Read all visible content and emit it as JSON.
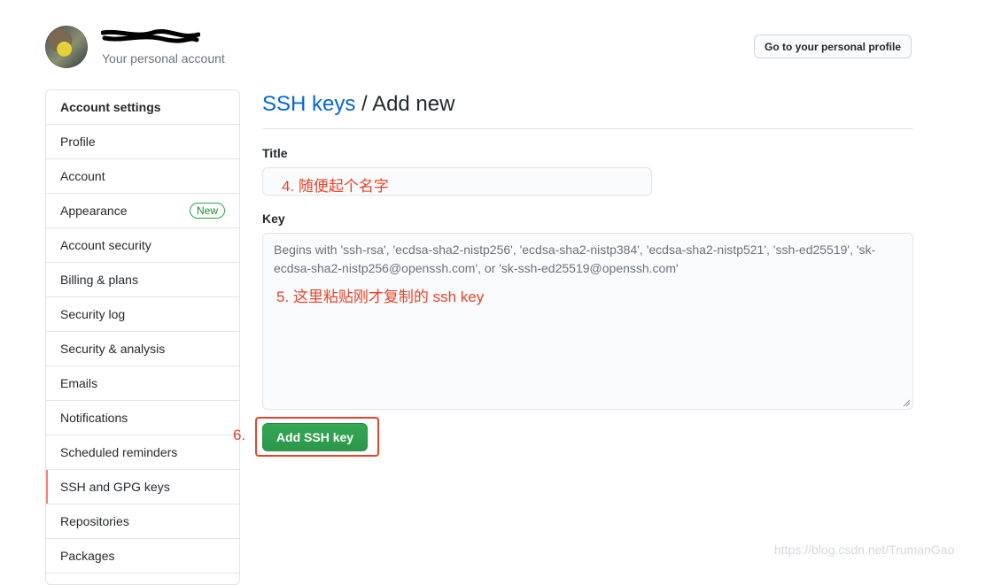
{
  "header": {
    "subtitle": "Your personal account",
    "profile_button": "Go to your personal profile"
  },
  "sidebar": {
    "title": "Account settings",
    "items": [
      {
        "label": "Profile"
      },
      {
        "label": "Account"
      },
      {
        "label": "Appearance",
        "badge": "New"
      },
      {
        "label": "Account security"
      },
      {
        "label": "Billing & plans"
      },
      {
        "label": "Security log"
      },
      {
        "label": "Security & analysis"
      },
      {
        "label": "Emails"
      },
      {
        "label": "Notifications"
      },
      {
        "label": "Scheduled reminders"
      },
      {
        "label": "SSH and GPG keys",
        "selected": true
      },
      {
        "label": "Repositories"
      },
      {
        "label": "Packages"
      }
    ]
  },
  "main": {
    "breadcrumb_link": "SSH keys",
    "breadcrumb_sep": " / ",
    "breadcrumb_current": "Add new",
    "title_label": "Title",
    "key_label": "Key",
    "key_placeholder": "Begins with 'ssh-rsa', 'ecdsa-sha2-nistp256', 'ecdsa-sha2-nistp384', 'ecdsa-sha2-nistp521', 'ssh-ed25519', 'sk-ecdsa-sha2-nistp256@openssh.com', or 'sk-ssh-ed25519@openssh.com'",
    "submit_label": "Add SSH key"
  },
  "annotations": {
    "step4": "4. 随便起个名字",
    "step5": "5. 这里粘贴刚才复制的 ssh key",
    "step6": "6."
  },
  "watermark": "https://blog.csdn.net/TrumanGao",
  "colors": {
    "link": "#0366d6",
    "primary_button": "#2ea44f",
    "annotation_red": "#e8432a",
    "selected_accent": "#f9826c",
    "badge_green": "#28a745"
  }
}
